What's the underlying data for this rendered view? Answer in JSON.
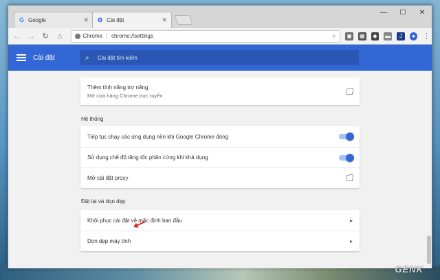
{
  "browser": {
    "tabs": [
      {
        "label": "Google",
        "icon": "google-g-icon"
      },
      {
        "label": "Cài đặt",
        "icon": "gear-icon"
      }
    ],
    "omnibox": {
      "chip": "Chrome",
      "url": "chrome://settings"
    },
    "window_controls": {
      "minimize": "—",
      "maximize": "☐",
      "close": "✕"
    }
  },
  "settings": {
    "title": "Cài đặt",
    "search_placeholder": "Cài đặt tìm kiếm",
    "accent_color": "#3367d6",
    "top_card": {
      "title": "Thêm tính năng trợ năng",
      "subtitle": "Mở cửa hàng Chrome trực tuyến"
    },
    "system": {
      "heading": "Hệ thống",
      "rows": [
        {
          "label": "Tiếp tục chạy các ứng dụng nền khi Google Chrome đóng",
          "control": "toggle-on"
        },
        {
          "label": "Sử dụng chế độ tăng tốc phần cứng khi khả dụng",
          "control": "toggle-on"
        },
        {
          "label": "Mở cài đặt proxy",
          "control": "external-link"
        }
      ]
    },
    "reset": {
      "heading": "Đặt lại và dọn dẹp",
      "rows": [
        {
          "label": "Khôi phục cài đặt về mặc định ban đầu",
          "control": "chevron"
        },
        {
          "label": "Dọn dẹp máy tính",
          "control": "chevron"
        }
      ]
    }
  },
  "watermark": "GENK"
}
